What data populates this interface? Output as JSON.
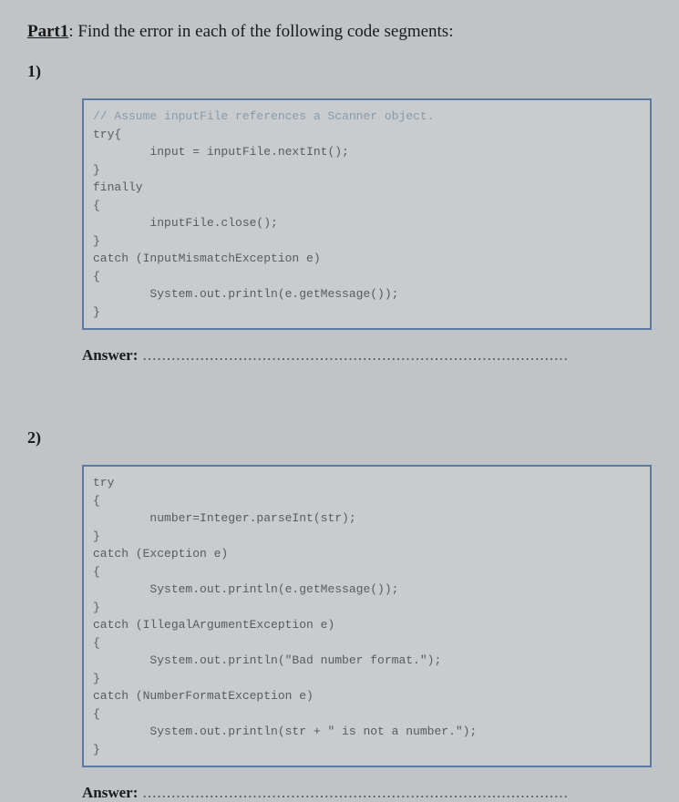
{
  "header": {
    "part": "Part1",
    "rest": ": Find the error in each of the following code segments:"
  },
  "q1": {
    "num": "1)",
    "code_comment": "// Assume inputFile references a Scanner object.",
    "code_lines": "try{\n        input = inputFile.nextInt();\n}\nfinally\n{\n        inputFile.close();\n}\ncatch (InputMismatchException e)\n{\n        System.out.println(e.getMessage());\n}",
    "answer_label": "Answer:",
    "answer_dots": " ........................................................................................."
  },
  "q2": {
    "num": "2)",
    "code_lines": "try\n{\n        number=Integer.parseInt(str);\n}\ncatch (Exception e)\n{\n        System.out.println(e.getMessage());\n}\ncatch (IllegalArgumentException e)\n{\n        System.out.println(\"Bad number format.\");\n}\ncatch (NumberFormatException e)\n{\n        System.out.println(str + \" is not a number.\");\n}",
    "answer_label": "Answer:",
    "answer_dots": " ........................................................................................."
  }
}
